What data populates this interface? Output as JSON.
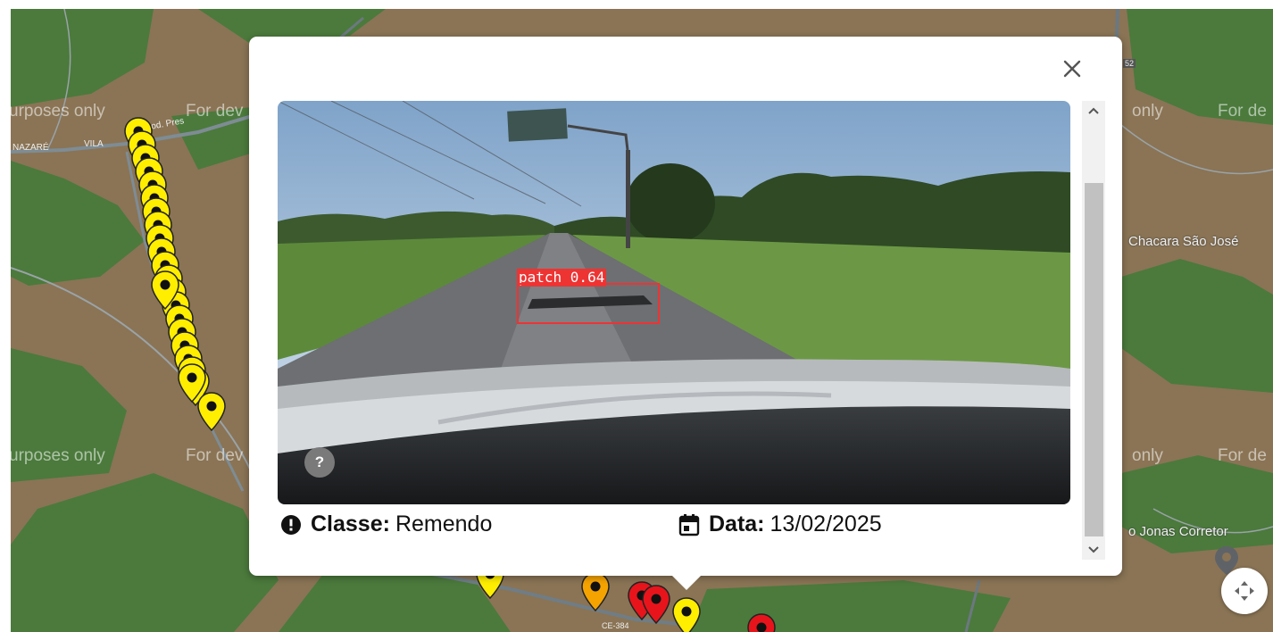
{
  "map": {
    "watermarks": [
      "urposes only",
      "For dev",
      "only",
      "For de",
      "urposes only",
      "For dev",
      "only",
      "For de"
    ],
    "labels": {
      "chacara": "Chacara São José",
      "jonas": "o Jonas Corretor",
      "nazare": "NAZARÉ",
      "vila": "VILA",
      "rod": "Rod. Pres",
      "ce384": "CE-384",
      "partial_shield": "52"
    },
    "recenter_icon": "recenter-arrows-icon",
    "pin_colors": {
      "yellow": "#ffee00",
      "orange": "#f5a300",
      "red": "#e8141c"
    }
  },
  "popup": {
    "close_icon": "close-icon",
    "detection": {
      "label": "patch 0.64"
    },
    "help_label": "?",
    "class_label": "Classe:",
    "class_value": "Remendo",
    "date_label": "Data:",
    "date_value": "13/02/2025",
    "class_icon": "alert-circle-icon",
    "date_icon": "calendar-icon"
  }
}
